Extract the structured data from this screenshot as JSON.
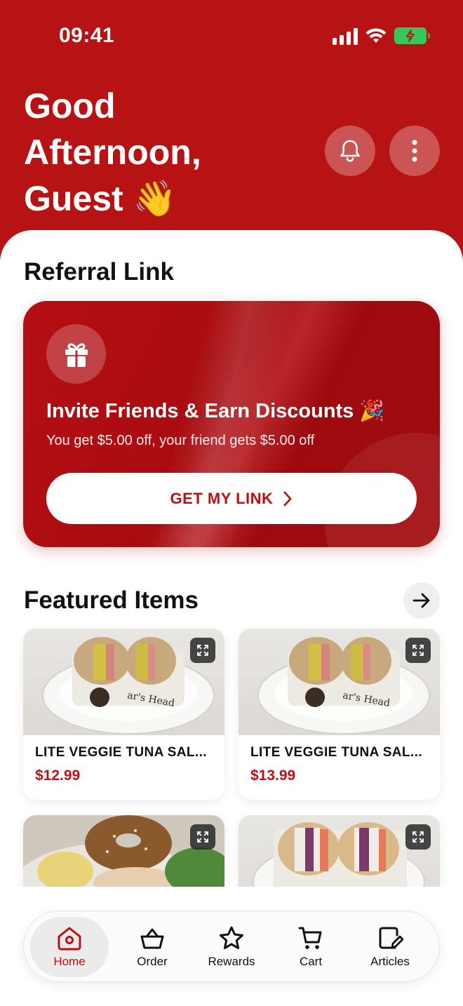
{
  "status_bar": {
    "time": "09:41"
  },
  "header": {
    "greeting_line1": "Good",
    "greeting_line2": "Afternoon,",
    "greeting_line3": "Guest 👋"
  },
  "referral": {
    "section_title": "Referral Link",
    "headline": "Invite Friends & Earn Discounts 🎉",
    "subtext": "You get $5.00 off, your friend gets $5.00 off",
    "button_label": "GET MY LINK"
  },
  "featured": {
    "section_title": "Featured Items",
    "items": [
      {
        "name": "LITE VEGGIE TUNA SAL...",
        "price": "$12.99"
      },
      {
        "name": "LITE VEGGIE TUNA SAL...",
        "price": "$13.99"
      },
      {
        "name": "",
        "price": ""
      },
      {
        "name": "",
        "price": ""
      }
    ]
  },
  "tab_bar": {
    "items": [
      {
        "label": "Home",
        "icon": "home-icon",
        "active": true
      },
      {
        "label": "Order",
        "icon": "basket-icon",
        "active": false
      },
      {
        "label": "Rewards",
        "icon": "star-icon",
        "active": false
      },
      {
        "label": "Cart",
        "icon": "cart-icon",
        "active": false
      },
      {
        "label": "Articles",
        "icon": "edit-note-icon",
        "active": false
      }
    ]
  },
  "colors": {
    "brand": "#b71314",
    "battery": "#35c759",
    "white": "#ffffff"
  }
}
